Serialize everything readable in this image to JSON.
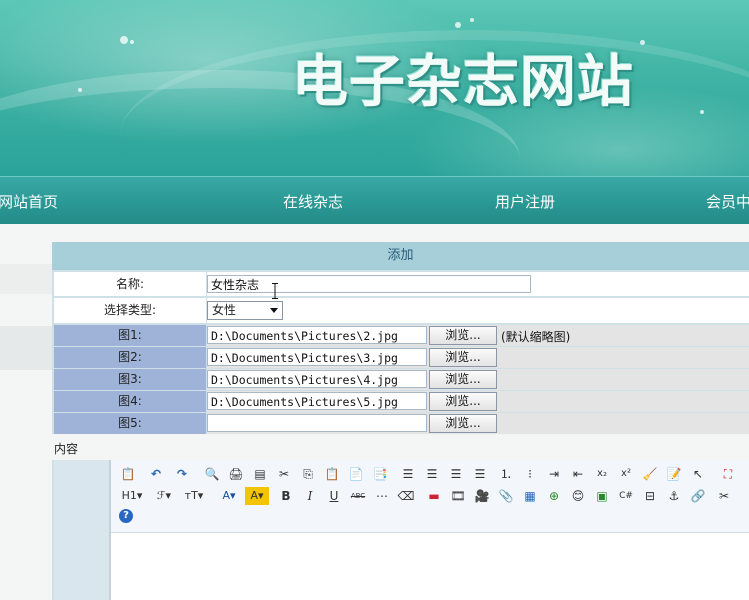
{
  "banner": {
    "title": "电子杂志网站"
  },
  "nav": {
    "items": [
      "网站首页",
      "在线杂志",
      "用户注册",
      "会员中"
    ]
  },
  "form": {
    "header": "添加",
    "name_label": "名称:",
    "name_value": "女性杂志",
    "type_label": "选择类型:",
    "type_selected": "女性",
    "images": [
      {
        "label": "图1:",
        "value": "D:\\Documents\\Pictures\\2.jpg",
        "browse": "浏览...",
        "note": "(默认缩略图)"
      },
      {
        "label": "图2:",
        "value": "D:\\Documents\\Pictures\\3.jpg",
        "browse": "浏览...",
        "note": ""
      },
      {
        "label": "图3:",
        "value": "D:\\Documents\\Pictures\\4.jpg",
        "browse": "浏览...",
        "note": ""
      },
      {
        "label": "图4:",
        "value": "D:\\Documents\\Pictures\\5.jpg",
        "browse": "浏览...",
        "note": ""
      },
      {
        "label": "图5:",
        "value": "",
        "browse": "浏览...",
        "note": ""
      }
    ],
    "content_label": "内容"
  },
  "editor": {
    "toolbar_row1": [
      "paste-word-icon",
      "undo-icon",
      "redo-icon",
      "preview-icon",
      "print-icon",
      "template-icon",
      "cut-icon",
      "copy-icon",
      "paste-icon",
      "paste-text-icon",
      "paste-format-icon",
      "align-left-icon",
      "align-center-icon",
      "align-right-icon",
      "justify-icon",
      "ordered-list-icon",
      "unordered-list-icon",
      "indent-icon",
      "outdent-icon",
      "subscript-icon",
      "superscript-icon",
      "clear-format-icon",
      "select-all-icon",
      "cursor-icon",
      "fullscreen-icon"
    ],
    "toolbar_row2": [
      "H1▾",
      "ℱ▾",
      "тT▾",
      "A▾",
      "A▾",
      "B",
      "I",
      "U",
      "ABC",
      "hr-icon",
      "eraser-icon",
      "image-icon",
      "flash-icon",
      "media-icon",
      "attach-icon",
      "table-icon",
      "insert-row-icon",
      "emoticon-icon",
      "picture-icon",
      "code-icon",
      "pagebreak-icon",
      "anchor-icon",
      "link-icon",
      "unlink-icon"
    ],
    "help_icon": "help-icon"
  }
}
